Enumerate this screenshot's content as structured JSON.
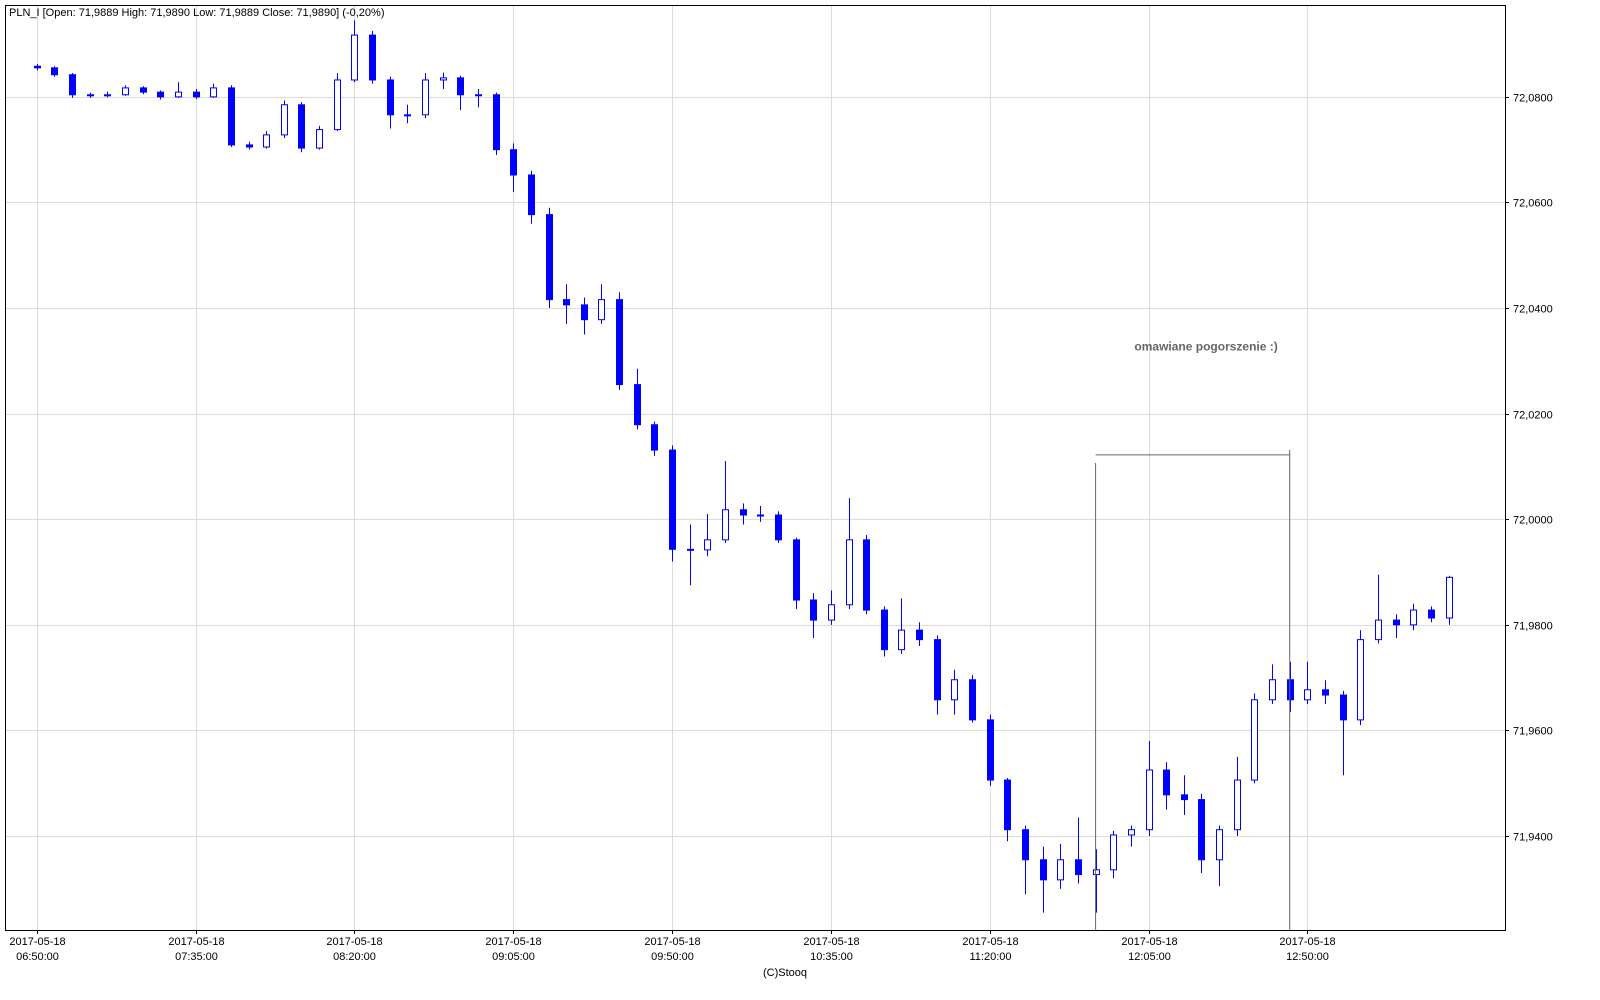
{
  "header": {
    "text": "PLN_I [Open: 71,9889  High: 71,9890  Low: 71,9889  Close: 71,9890] (-0,20%)"
  },
  "footer": {
    "credit": "(C)Stooq"
  },
  "colors": {
    "candle": "#0000ff",
    "annotation": "#666666",
    "grid": "#dcdcdc"
  },
  "chart_data": {
    "type": "candlestick",
    "title": "PLN_I",
    "date": "2017-05-18",
    "start_time": "06:50",
    "interval_minutes": 5,
    "ylim": [
      71.9222,
      72.0974
    ],
    "x_range_minutes": [
      -9,
      416
    ],
    "grid": true,
    "y_ticks": [
      {
        "value": 72.08,
        "label": "72,0800"
      },
      {
        "value": 72.06,
        "label": "72,0600"
      },
      {
        "value": 72.04,
        "label": "72,0400"
      },
      {
        "value": 72.02,
        "label": "72,0200"
      },
      {
        "value": 72.0,
        "label": "72,0000"
      },
      {
        "value": 71.98,
        "label": "71,9800"
      },
      {
        "value": 71.96,
        "label": "71,9600"
      },
      {
        "value": 71.94,
        "label": "71,9400"
      }
    ],
    "x_ticks": [
      {
        "minute": 0,
        "date": "2017-05-18",
        "time": "06:50:00"
      },
      {
        "minute": 45,
        "date": "2017-05-18",
        "time": "07:35:00"
      },
      {
        "minute": 90,
        "date": "2017-05-18",
        "time": "08:20:00"
      },
      {
        "minute": 135,
        "date": "2017-05-18",
        "time": "09:05:00"
      },
      {
        "minute": 180,
        "date": "2017-05-18",
        "time": "09:50:00"
      },
      {
        "minute": 225,
        "date": "2017-05-18",
        "time": "10:35:00"
      },
      {
        "minute": 270,
        "date": "2017-05-18",
        "time": "11:20:00"
      },
      {
        "minute": 315,
        "date": "2017-05-18",
        "time": "12:05:00"
      },
      {
        "minute": 360,
        "date": "2017-05-18",
        "time": "12:50:00"
      }
    ],
    "annotation": {
      "text": "omawiane pogorszenie :)",
      "text_minute": 311,
      "text_value": 72.032,
      "bracket_start_minute": 300,
      "bracket_end_minute": 355,
      "bracket_value": 72.0122
    },
    "ohlc": [
      [
        72.0858,
        72.0862,
        72.085,
        72.0855
      ],
      [
        72.0855,
        72.0858,
        72.0838,
        72.0842
      ],
      [
        72.0842,
        72.0845,
        72.0798,
        72.0804
      ],
      [
        72.0804,
        72.0808,
        72.0798,
        72.0802
      ],
      [
        72.0802,
        72.081,
        72.0799,
        72.0804
      ],
      [
        72.0804,
        72.0822,
        72.0802,
        72.0817
      ],
      [
        72.0817,
        72.082,
        72.0805,
        72.0809
      ],
      [
        72.0809,
        72.0812,
        72.0795,
        72.08
      ],
      [
        72.08,
        72.0828,
        72.0798,
        72.0809
      ],
      [
        72.0809,
        72.0815,
        72.0796,
        72.08
      ],
      [
        72.08,
        72.0825,
        72.0798,
        72.0817
      ],
      [
        72.0817,
        72.0822,
        72.0705,
        72.0709
      ],
      [
        72.0709,
        72.0715,
        72.07,
        72.0705
      ],
      [
        72.0705,
        72.0735,
        72.0702,
        72.0728
      ],
      [
        72.0728,
        72.0793,
        72.0722,
        72.0785
      ],
      [
        72.0785,
        72.079,
        72.0695,
        72.0703
      ],
      [
        72.0703,
        72.0745,
        72.07,
        72.0738
      ],
      [
        72.0738,
        72.0845,
        72.0735,
        72.0832
      ],
      [
        72.0832,
        72.0945,
        72.0828,
        72.0917
      ],
      [
        72.0917,
        72.0925,
        72.0825,
        72.0832
      ],
      [
        72.0832,
        72.0838,
        72.074,
        72.0766
      ],
      [
        72.0766,
        72.0785,
        72.075,
        72.0766
      ],
      [
        72.0766,
        72.0845,
        72.076,
        72.0832
      ],
      [
        72.0832,
        72.0846,
        72.0815,
        72.0836
      ],
      [
        72.0836,
        72.084,
        72.0775,
        72.0804
      ],
      [
        72.0804,
        72.0815,
        72.078,
        72.0804
      ],
      [
        72.0804,
        72.0808,
        72.069,
        72.07
      ],
      [
        72.07,
        72.0712,
        72.062,
        72.0652
      ],
      [
        72.0652,
        72.066,
        72.056,
        72.0577
      ],
      [
        72.0577,
        72.059,
        72.04,
        72.0416
      ],
      [
        72.0416,
        72.0445,
        72.037,
        72.0406
      ],
      [
        72.0406,
        72.042,
        72.035,
        72.0378
      ],
      [
        72.0378,
        72.0445,
        72.037,
        72.0416
      ],
      [
        72.0416,
        72.043,
        72.0245,
        72.0255
      ],
      [
        72.0255,
        72.0285,
        72.017,
        72.0179
      ],
      [
        72.0179,
        72.0185,
        72.012,
        72.0131
      ],
      [
        72.0131,
        72.014,
        71.992,
        71.9943
      ],
      [
        71.9943,
        71.999,
        71.9875,
        71.9942
      ],
      [
        71.9942,
        72.001,
        71.993,
        71.9961
      ],
      [
        71.9961,
        72.011,
        71.9955,
        72.0018
      ],
      [
        72.0018,
        72.003,
        71.999,
        72.0008
      ],
      [
        72.0008,
        72.0025,
        71.9995,
        72.0008
      ],
      [
        72.0008,
        72.0015,
        71.9955,
        71.9961
      ],
      [
        71.9961,
        71.9965,
        71.983,
        71.9847
      ],
      [
        71.9847,
        71.986,
        71.9775,
        71.9809
      ],
      [
        71.9809,
        71.9865,
        71.98,
        71.9838
      ],
      [
        71.9838,
        72.004,
        71.983,
        71.9961
      ],
      [
        71.9961,
        71.997,
        71.982,
        71.9828
      ],
      [
        71.9828,
        71.9835,
        71.974,
        71.9753
      ],
      [
        71.9753,
        71.985,
        71.9745,
        71.979
      ],
      [
        71.979,
        71.9805,
        71.976,
        71.9772
      ],
      [
        71.9772,
        71.978,
        71.963,
        71.9658
      ],
      [
        71.9658,
        71.9715,
        71.963,
        71.9696
      ],
      [
        71.9696,
        71.9705,
        71.9615,
        71.962
      ],
      [
        71.962,
        71.963,
        71.9495,
        71.9506
      ],
      [
        71.9506,
        71.951,
        71.939,
        71.9412
      ],
      [
        71.9412,
        71.942,
        71.929,
        71.9355
      ],
      [
        71.9355,
        71.938,
        71.9255,
        71.9317
      ],
      [
        71.9317,
        71.9385,
        71.93,
        71.9355
      ],
      [
        71.9355,
        71.9435,
        71.931,
        71.9327
      ],
      [
        71.9327,
        71.9375,
        71.9255,
        71.9336
      ],
      [
        71.9336,
        71.941,
        71.932,
        71.9402
      ],
      [
        71.9402,
        71.942,
        71.938,
        71.9412
      ],
      [
        71.9412,
        71.958,
        71.94,
        71.9525
      ],
      [
        71.9525,
        71.954,
        71.945,
        71.9478
      ],
      [
        71.9478,
        71.9515,
        71.944,
        71.9469
      ],
      [
        71.9469,
        71.948,
        71.933,
        71.9355
      ],
      [
        71.9355,
        71.942,
        71.9305,
        71.9412
      ],
      [
        71.9412,
        71.955,
        71.94,
        71.9506
      ],
      [
        71.9506,
        71.967,
        71.95,
        71.9658
      ],
      [
        71.9658,
        71.9725,
        71.965,
        71.9696
      ],
      [
        71.9696,
        71.973,
        71.9635,
        71.9658
      ],
      [
        71.9658,
        71.973,
        71.965,
        71.9677
      ],
      [
        71.9677,
        71.9695,
        71.965,
        71.9667
      ],
      [
        71.9667,
        71.9675,
        71.9515,
        71.962
      ],
      [
        71.962,
        71.979,
        71.961,
        71.9772
      ],
      [
        71.9772,
        71.9895,
        71.9765,
        71.9809
      ],
      [
        71.9809,
        71.982,
        71.9775,
        71.98
      ],
      [
        71.98,
        71.984,
        71.979,
        71.9828
      ],
      [
        71.9828,
        71.9835,
        71.9805,
        71.9813
      ],
      [
        71.9813,
        71.9893,
        71.98,
        71.989
      ]
    ]
  }
}
